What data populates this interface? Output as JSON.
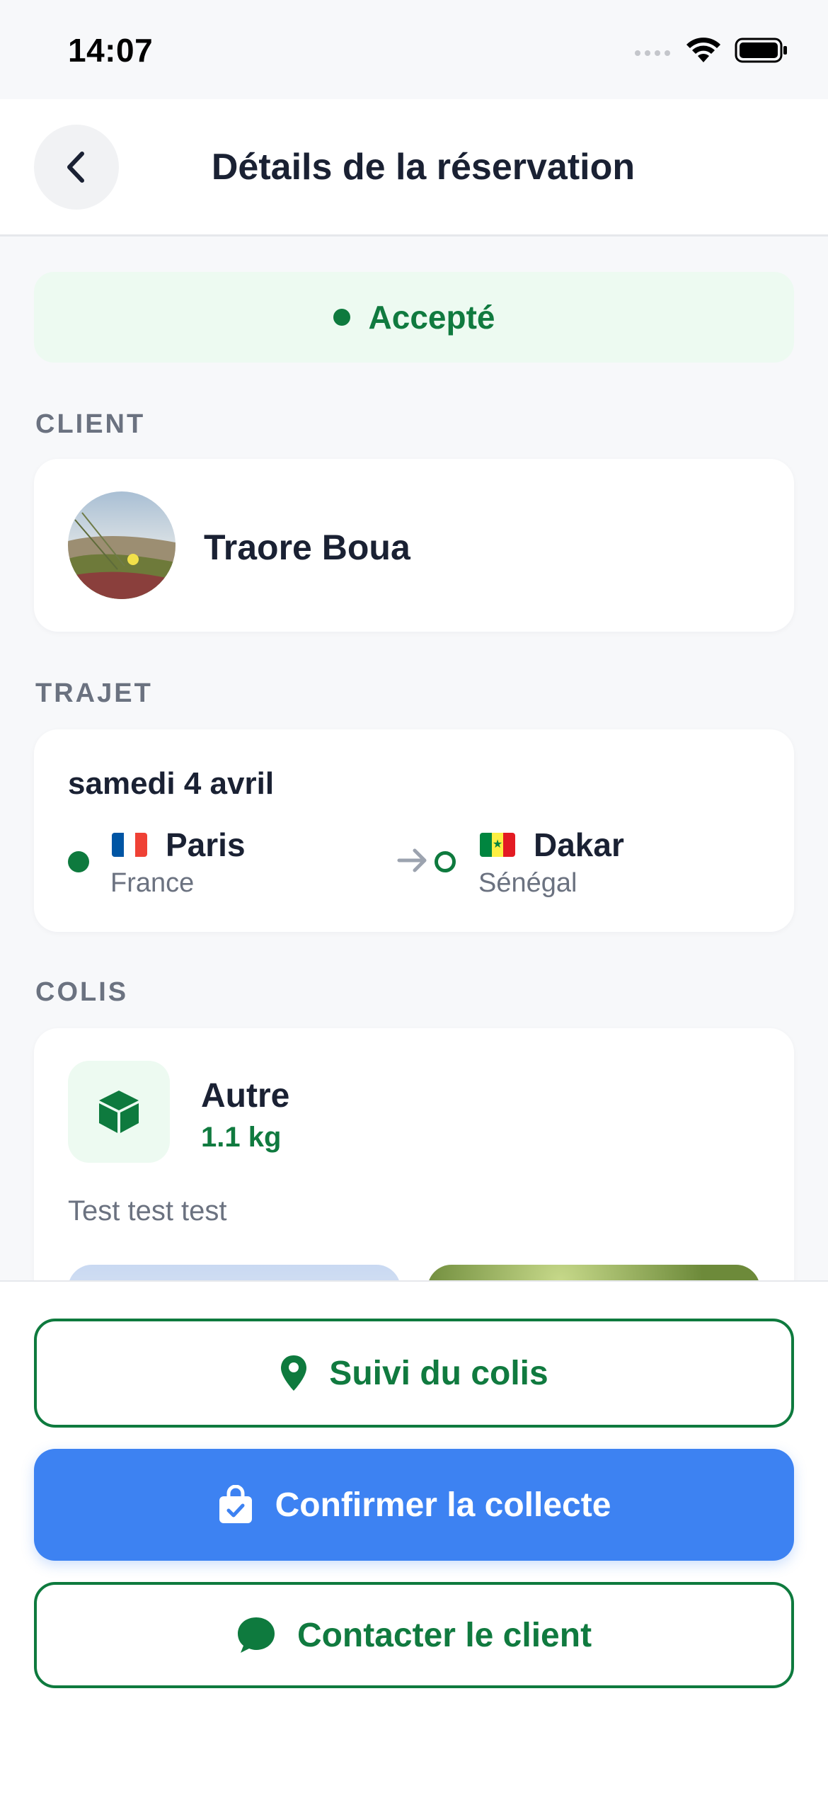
{
  "status_bar": {
    "time": "14:07"
  },
  "header": {
    "title": "Détails de la réservation"
  },
  "reservation_status": {
    "label": "Accepté",
    "color": "#107A3F"
  },
  "client": {
    "section_label": "CLIENT",
    "name": "Traore Boua"
  },
  "trip": {
    "section_label": "TRAJET",
    "date": "samedi 4 avril",
    "from": {
      "city": "Paris",
      "country": "France",
      "flag": "flag-france-icon"
    },
    "to": {
      "city": "Dakar",
      "country": "Sénégal",
      "flag": "flag-senegal-icon"
    }
  },
  "package": {
    "section_label": "COLIS",
    "type": "Autre",
    "weight": "1.1 kg",
    "description": "Test test test"
  },
  "actions": {
    "track_label": "Suivi du colis",
    "confirm_label": "Confirmer la collecte",
    "contact_label": "Contacter le client"
  },
  "colors": {
    "primary_green": "#0E7A3E",
    "accent_blue": "#3D82F2",
    "status_bg": "#EDFAF1"
  }
}
